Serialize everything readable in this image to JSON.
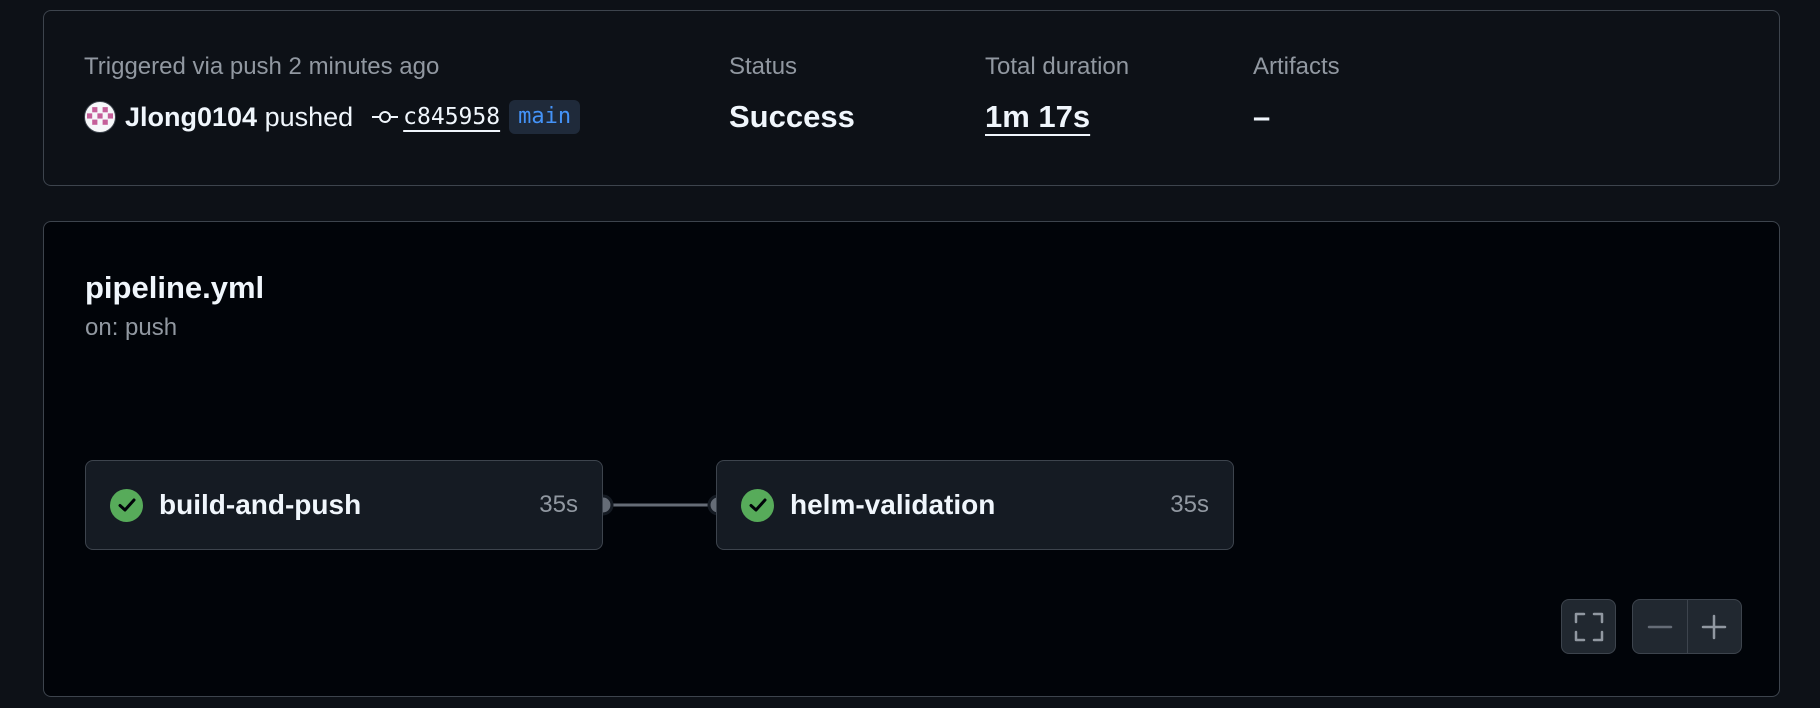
{
  "summary": {
    "trigger_label": "Triggered via push 2 minutes ago",
    "actor": "Jlong0104",
    "action": "pushed",
    "commit_sha": "c845958",
    "branch": "main",
    "status_label": "Status",
    "status_value": "Success",
    "duration_label": "Total duration",
    "duration_value": "1m 17s",
    "artifacts_label": "Artifacts",
    "artifacts_value": "–"
  },
  "workflow": {
    "name": "pipeline.yml",
    "trigger": "on: push",
    "jobs": [
      {
        "name": "build-and-push",
        "duration": "35s",
        "status": "success"
      },
      {
        "name": "helm-validation",
        "duration": "35s",
        "status": "success"
      }
    ]
  },
  "controls": {
    "fullscreen_icon": "fullscreen-icon",
    "zoom_out_icon": "minus-icon",
    "zoom_in_icon": "plus-icon"
  },
  "colors": {
    "success": "#57ab5a",
    "branch": "#4493f8",
    "background": "#0d1117",
    "graph_background": "#010409"
  }
}
